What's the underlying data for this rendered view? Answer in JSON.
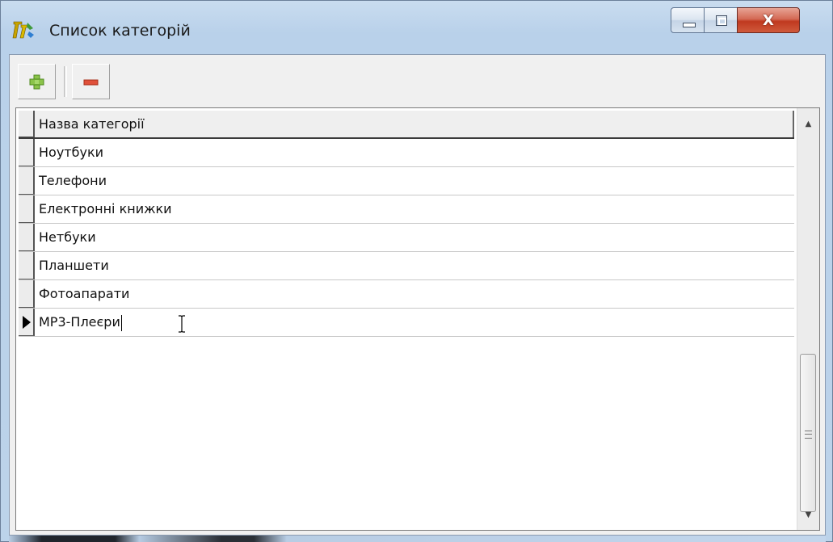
{
  "window": {
    "title": "Список категорій",
    "icon": "delphi-app-icon",
    "controls": {
      "minimize_icon": "minimize-icon",
      "maximize_icon": "maximize-icon",
      "close_icon": "close-icon",
      "close_glyph": "X"
    }
  },
  "toolbar": {
    "add_icon": "plus-icon",
    "delete_icon": "minus-icon",
    "colors": {
      "add": "#8bc34a",
      "delete": "#e0503a"
    }
  },
  "grid": {
    "header": "Назва категорії",
    "rows": [
      "Ноутбуки",
      "Телефони",
      "Електронні книжки",
      "Нетбуки",
      "Планшети",
      "Фотоапарати",
      "МР3-Плеєри"
    ],
    "current_row_index": 6
  },
  "scrollbar": {
    "up_icon": "scroll-up-arrow-icon",
    "down_icon": "scroll-down-arrow-icon"
  }
}
